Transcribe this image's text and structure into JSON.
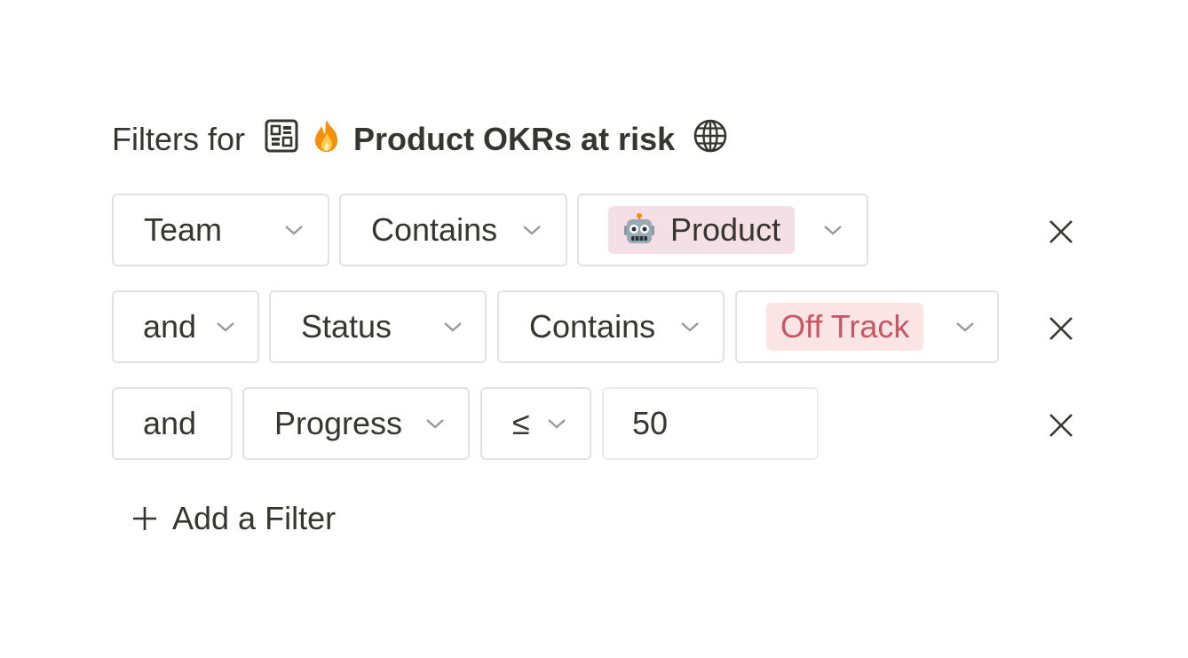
{
  "header": {
    "prefix": "Filters for",
    "view_icon": "database-grid-icon",
    "emoji_icon": "fire-icon",
    "view_name": "Product OKRs at risk",
    "trailing_icon": "globe-icon"
  },
  "filters": [
    {
      "conjunction": "",
      "property": "Team",
      "operator": "Contains",
      "value": "Product",
      "value_icon": "robot-icon",
      "value_style": "tag",
      "value_color": "#f5dfe6"
    },
    {
      "conjunction": "and",
      "property": "Status",
      "operator": "Contains",
      "value": "Off Track",
      "value_style": "tag",
      "value_color": "#fbe4e4",
      "value_text_color": "#c55864"
    },
    {
      "conjunction": "and",
      "property": "Progress",
      "operator": "≤",
      "value": "50",
      "value_style": "input"
    }
  ],
  "add_filter": {
    "label": "Add a Filter",
    "icon": "plus-icon"
  },
  "icons": {
    "dropdown": "chevron-down-icon",
    "remove": "close-icon"
  }
}
